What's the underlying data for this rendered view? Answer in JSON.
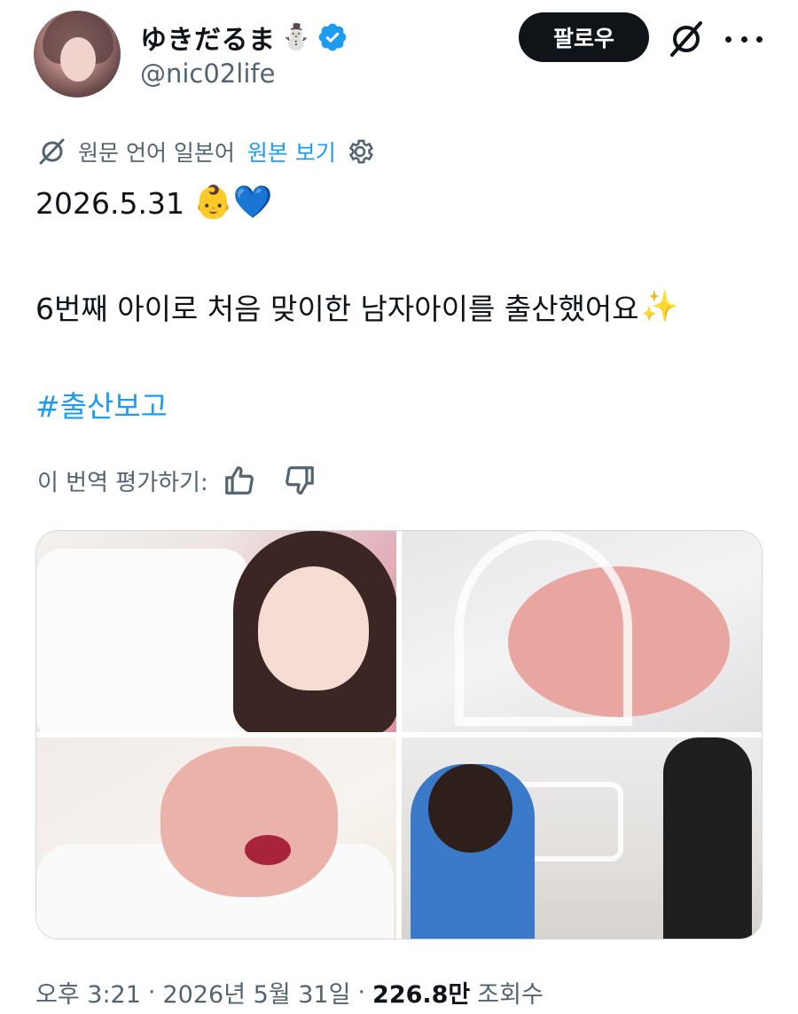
{
  "author": {
    "display_name": "ゆきだるま",
    "name_emoji": "⛄",
    "handle": "@nic02life",
    "verified": true,
    "avatar_icon": "avatar-photo"
  },
  "header": {
    "follow_label": "팔로우",
    "grok_icon": "grok-icon",
    "more_icon": "more-icon"
  },
  "translation": {
    "label": "원문 언어 일본어",
    "show_original": "원본 보기",
    "rate_label": "이 번역 평가하기:"
  },
  "post": {
    "date_text": "2026.5.31",
    "date_emojis": "👶💙",
    "body_text": "6번째 아이로 처음 맞이한 남자아이를 출산했어요",
    "body_emoji": "✨",
    "hashtag": "#출산보고"
  },
  "meta": {
    "time": "오후 3:21",
    "separator": "·",
    "date": "2026년 5월 31일",
    "views_count": "226.8만",
    "views_label": "조회수"
  },
  "colors": {
    "link": "#1d9bf0",
    "text": "#0f1419",
    "muted": "#536471"
  }
}
